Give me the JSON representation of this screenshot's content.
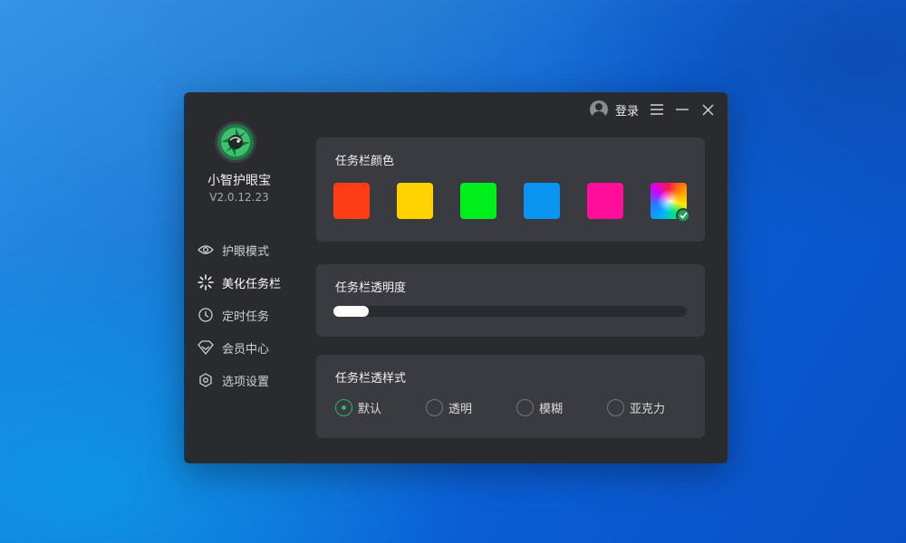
{
  "window": {
    "user": {
      "icon": "user-avatar-icon",
      "login_label": "登录"
    },
    "controls": {
      "menu": "menu-icon",
      "minimize": "minimize-icon",
      "close": "close-icon"
    }
  },
  "sidebar": {
    "logo_icon": "eye-camera-logo-icon",
    "app_name": "小智护眼宝",
    "version": "V2.0.12.23",
    "items": [
      {
        "label": "护眼模式",
        "icon": "eye-icon",
        "active": false
      },
      {
        "label": "美化任务栏",
        "icon": "sparkle-icon",
        "active": true
      },
      {
        "label": "定时任务",
        "icon": "clock-icon",
        "active": false
      },
      {
        "label": "会员中心",
        "icon": "diamond-icon",
        "active": false
      },
      {
        "label": "选项设置",
        "icon": "settings-hexagon-icon",
        "active": false
      }
    ]
  },
  "taskbar_color": {
    "title": "任务栏颜色",
    "swatches": [
      "#ff3d14",
      "#ffd200",
      "#00ee1c",
      "#0a95f2",
      "#ff0f99",
      "rainbow"
    ],
    "selected_index": 5
  },
  "taskbar_opacity": {
    "title": "任务栏透明度",
    "value_fraction": 0.1
  },
  "taskbar_style": {
    "title": "任务栏透样式",
    "options": [
      "默认",
      "透明",
      "模糊",
      "亚克力"
    ],
    "selected_index": 0
  },
  "colors": {
    "accent_green": "#2ab36b",
    "window_bg": "#2a2b2f",
    "card_bg": "#3a3b40"
  }
}
